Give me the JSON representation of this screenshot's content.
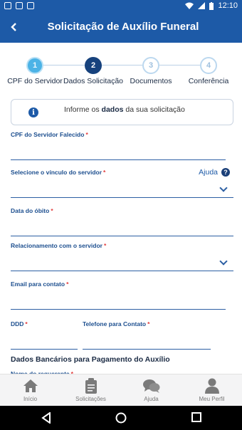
{
  "status_bar": {
    "time": "12:10"
  },
  "app_bar": {
    "title": "Solicitação de Auxílio Funeral",
    "back_icon": "chevron-left-icon"
  },
  "stepper": {
    "steps": [
      {
        "number": "1",
        "label": "CPF do Servidor",
        "state": "done"
      },
      {
        "number": "2",
        "label": "Dados Solicitação",
        "state": "active"
      },
      {
        "number": "3",
        "label": "Documentos",
        "state": "todo"
      },
      {
        "number": "4",
        "label": "Conferência",
        "state": "todo"
      }
    ]
  },
  "info": {
    "prefix": "Informe os ",
    "bold": "dados",
    "suffix": " da sua solicitação"
  },
  "form": {
    "cpf_label": "CPF do Servidor Falecido",
    "vinculo_label": "Selecione o vínculo do servidor",
    "ajuda_link": "Ajuda",
    "data_obito_label": "Data do óbito",
    "relacionamento_label": "Relacionamento com o servidor",
    "email_label": "Email para contato",
    "ddd_label": "DDD",
    "telefone_label": "Telefone para Contato",
    "required_mark": "*",
    "bank_section_title": "Dados Bancários para Pagamento do Auxílio",
    "nome_requerente_label": "Nome do requerente"
  },
  "bottom_nav": [
    {
      "label": "Início",
      "icon": "home-icon"
    },
    {
      "label": "Solicitações",
      "icon": "clipboard-icon"
    },
    {
      "label": "Ajuda",
      "icon": "chat-bubbles-icon"
    },
    {
      "label": "Meu Perfil",
      "icon": "person-icon"
    }
  ],
  "colors": {
    "primary": "#1d5aa7",
    "accent_done": "#4cb3e6",
    "active_step": "#17427d",
    "required": "#e23b3b"
  }
}
